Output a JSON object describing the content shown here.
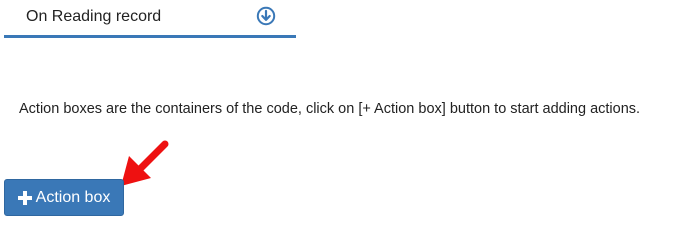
{
  "event_selector": {
    "label": "On Reading record",
    "icon": "circle-arrow-down-icon"
  },
  "info": {
    "text": "Action boxes are the containers of the code, click on [+ Action box] button to start adding actions."
  },
  "action_button": {
    "label": "Action box",
    "icon": "plus-icon"
  },
  "colors": {
    "accent": "#3a78b7",
    "arrow": "#ee1111",
    "text": "#222222"
  }
}
